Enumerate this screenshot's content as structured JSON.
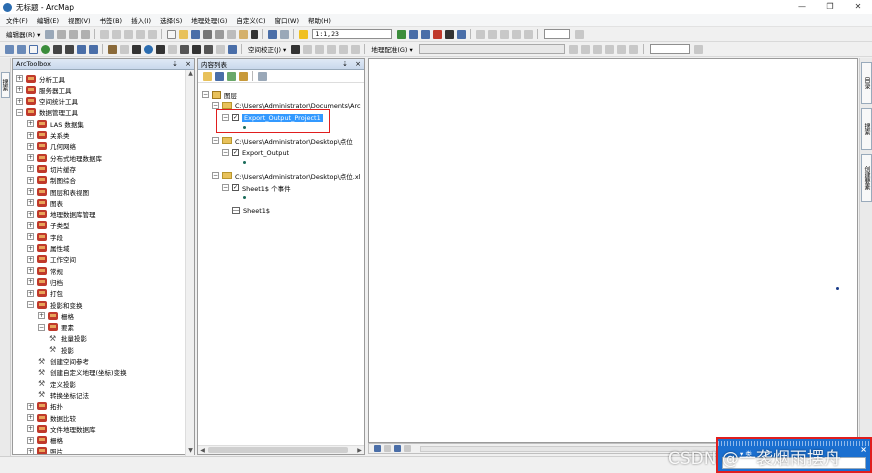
{
  "window": {
    "title": "无标题 - ArcMap",
    "controls": [
      "—",
      "❐",
      "✕"
    ]
  },
  "menubar": {
    "items": [
      "文件(F)",
      "编辑(E)",
      "视图(V)",
      "书签(B)",
      "插入(I)",
      "选择(S)",
      "地理处理(G)",
      "自定义(C)",
      "窗口(W)",
      "帮助(H)"
    ]
  },
  "toolbar": {
    "editor_label": "编辑器(R) ▾",
    "scale_value": "1:1,23",
    "georef_label": "空间校正(J) ▾",
    "georeferencing_label": "地理配准(G) ▾"
  },
  "left_strip": {
    "tab_label": "搜索"
  },
  "toolbox": {
    "title": "ArcToolbox",
    "pin": "⇣",
    "close": "×",
    "items": [
      {
        "label": "分析工具",
        "level": 0,
        "exp": "+",
        "icon": "toolbox"
      },
      {
        "label": "服务器工具",
        "level": 0,
        "exp": "+",
        "icon": "toolbox"
      },
      {
        "label": "空间统计工具",
        "level": 0,
        "exp": "+",
        "icon": "toolbox"
      },
      {
        "label": "数据管理工具",
        "level": 0,
        "exp": "−",
        "icon": "toolbox"
      },
      {
        "label": "LAS 数据集",
        "level": 1,
        "exp": "+",
        "icon": "toolbox"
      },
      {
        "label": "关系类",
        "level": 1,
        "exp": "+",
        "icon": "toolbox"
      },
      {
        "label": "几何网络",
        "level": 1,
        "exp": "+",
        "icon": "toolbox"
      },
      {
        "label": "分布式地理数据库",
        "level": 1,
        "exp": "+",
        "icon": "toolbox"
      },
      {
        "label": "切片缓存",
        "level": 1,
        "exp": "+",
        "icon": "toolbox"
      },
      {
        "label": "制图综合",
        "level": 1,
        "exp": "+",
        "icon": "toolbox"
      },
      {
        "label": "图层和表视图",
        "level": 1,
        "exp": "+",
        "icon": "toolbox"
      },
      {
        "label": "图表",
        "level": 1,
        "exp": "+",
        "icon": "toolbox"
      },
      {
        "label": "地理数据库管理",
        "level": 1,
        "exp": "+",
        "icon": "toolbox"
      },
      {
        "label": "子类型",
        "level": 1,
        "exp": "+",
        "icon": "toolbox"
      },
      {
        "label": "字段",
        "level": 1,
        "exp": "+",
        "icon": "toolbox"
      },
      {
        "label": "属性域",
        "level": 1,
        "exp": "+",
        "icon": "toolbox"
      },
      {
        "label": "工作空间",
        "level": 1,
        "exp": "+",
        "icon": "toolbox"
      },
      {
        "label": "常规",
        "level": 1,
        "exp": "+",
        "icon": "toolbox"
      },
      {
        "label": "归档",
        "level": 1,
        "exp": "+",
        "icon": "toolbox"
      },
      {
        "label": "打包",
        "level": 1,
        "exp": "+",
        "icon": "toolbox"
      },
      {
        "label": "投影和变换",
        "level": 1,
        "exp": "−",
        "icon": "toolbox"
      },
      {
        "label": "栅格",
        "level": 2,
        "exp": "+",
        "icon": "toolbox"
      },
      {
        "label": "要素",
        "level": 2,
        "exp": "−",
        "icon": "toolbox"
      },
      {
        "label": "批量投影",
        "level": 3,
        "exp": "",
        "icon": "tool"
      },
      {
        "label": "投影",
        "level": 3,
        "exp": "",
        "icon": "tool"
      },
      {
        "label": "创建空间参考",
        "level": 2,
        "exp": "",
        "icon": "tool"
      },
      {
        "label": "创建自定义地理(坐标)变换",
        "level": 2,
        "exp": "",
        "icon": "tool"
      },
      {
        "label": "定义投影",
        "level": 2,
        "exp": "",
        "icon": "tool"
      },
      {
        "label": "转换坐标记法",
        "level": 2,
        "exp": "",
        "icon": "tool"
      },
      {
        "label": "拓扑",
        "level": 1,
        "exp": "+",
        "icon": "toolbox"
      },
      {
        "label": "数据比较",
        "level": 1,
        "exp": "+",
        "icon": "toolbox"
      },
      {
        "label": "文件地理数据库",
        "level": 1,
        "exp": "+",
        "icon": "toolbox"
      },
      {
        "label": "栅格",
        "level": 1,
        "exp": "+",
        "icon": "toolbox"
      },
      {
        "label": "照片",
        "level": 1,
        "exp": "+",
        "icon": "toolbox"
      }
    ]
  },
  "toc": {
    "title": "内容列表",
    "pin": "⇣",
    "close": "×",
    "root_label": "图层",
    "rows": [
      {
        "kind": "folder",
        "label": "C:\\Users\\Administrator\\Documents\\Arc",
        "level": 1
      },
      {
        "kind": "layer",
        "label": "Export_Output_Project1",
        "level": 2,
        "selected": true
      },
      {
        "kind": "folder",
        "label": "C:\\Users\\Administrator\\Desktop\\点位",
        "level": 1
      },
      {
        "kind": "layer",
        "label": "Export_Output",
        "level": 2,
        "selected": false
      },
      {
        "kind": "folder",
        "label": "C:\\Users\\Administrator\\Desktop\\点位.xl",
        "level": 1
      },
      {
        "kind": "layer",
        "label": "Sheet1$ 个事件",
        "level": 2,
        "selected": false
      },
      {
        "kind": "table",
        "label": "Sheet1$",
        "level": 2,
        "selected": false
      }
    ]
  },
  "right_strip": {
    "tabs": [
      "目录",
      "搜索",
      "创建要素"
    ]
  },
  "popup": {
    "label": "▾ 类",
    "close": "×"
  },
  "watermark": "CSDN @一袭烟雨摆舟",
  "colors": {
    "selection": "#3399ff",
    "highlight_box": "#e01e1e",
    "point_symbol": "#1a6b5a",
    "popup_bg": "#1a6fd0"
  }
}
